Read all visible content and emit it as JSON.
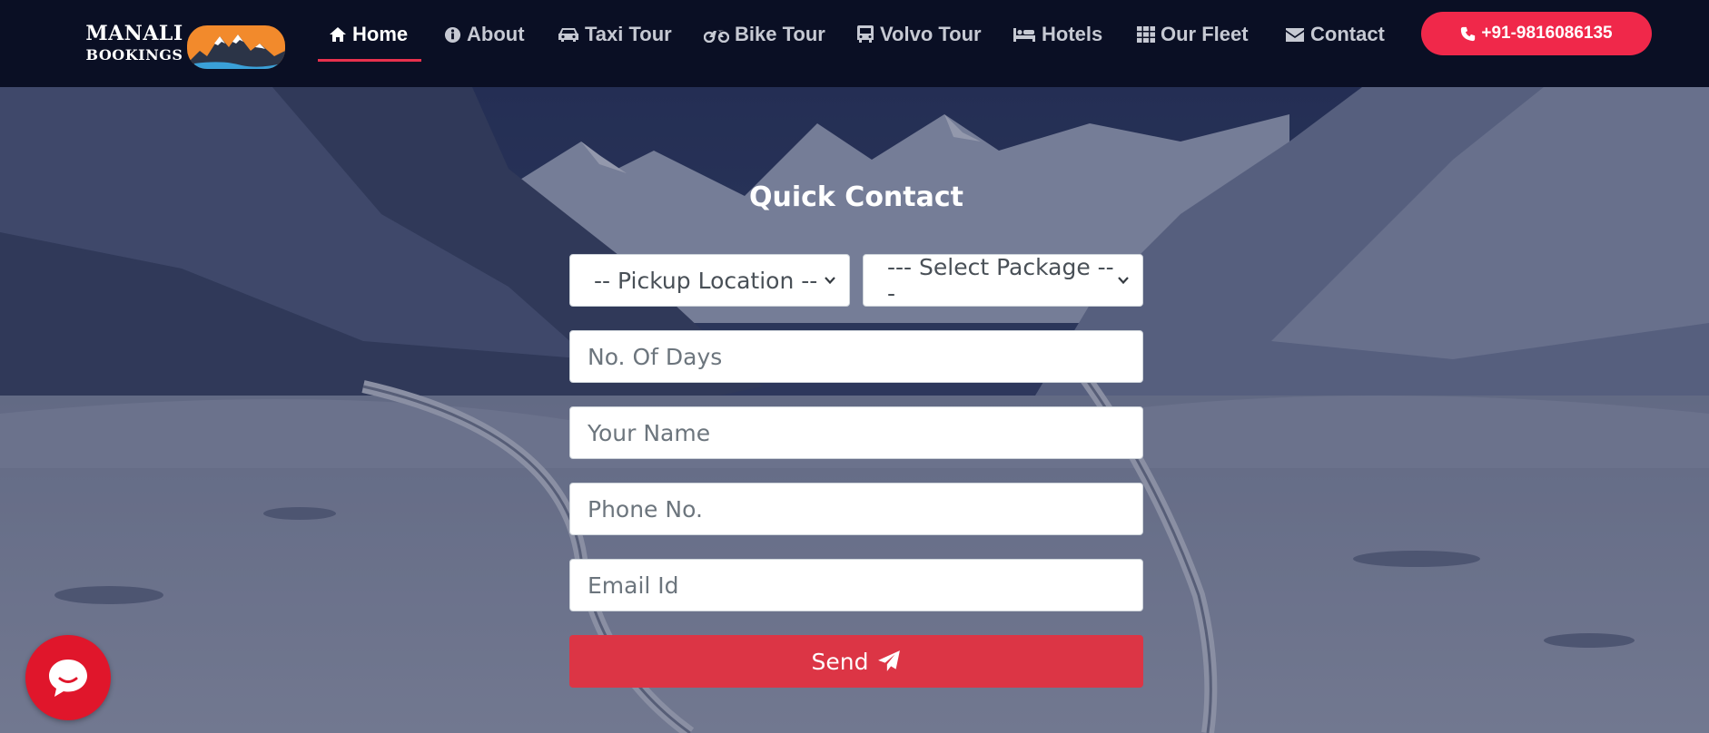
{
  "brand": {
    "line1": "MANALI",
    "line2": "BOOKINGS"
  },
  "nav": {
    "items": [
      {
        "label": "Home",
        "icon": "home-icon",
        "active": true
      },
      {
        "label": "About",
        "icon": "info-icon",
        "active": false
      },
      {
        "label": "Taxi Tour",
        "icon": "car-icon",
        "active": false
      },
      {
        "label": "Bike Tour",
        "icon": "motorcycle-icon",
        "active": false
      },
      {
        "label": "Volvo Tour",
        "icon": "bus-icon",
        "active": false
      },
      {
        "label": "Hotels",
        "icon": "bed-icon",
        "active": false
      },
      {
        "label": "Our Fleet",
        "icon": "grid-icon",
        "active": false
      },
      {
        "label": "Contact",
        "icon": "envelope-icon",
        "active": false
      }
    ],
    "phone": "+91-9816086135"
  },
  "form": {
    "title": "Quick Contact",
    "pickup_select": "-- Pickup Location --",
    "package_select": "--- Select Package ---",
    "days_placeholder": "No. Of Days",
    "name_placeholder": "Your Name",
    "phone_placeholder": "Phone No.",
    "email_placeholder": "Email Id",
    "send_label": "Send"
  },
  "colors": {
    "navbar_bg": "#0a0f24",
    "accent": "#f0284a",
    "send_button": "#dc3545",
    "chat_bubble": "#e0162b"
  }
}
